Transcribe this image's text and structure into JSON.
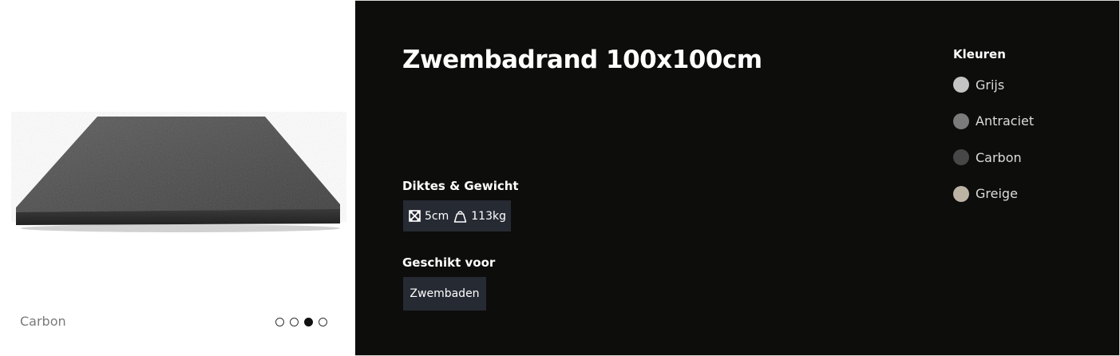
{
  "product": {
    "title": "Zwembadrand 100x100cm",
    "image_variant_label": "Carbon",
    "carousel": {
      "total_slides": 4,
      "active_slide": 3
    }
  },
  "specs": {
    "heading": "Diktes & Gewicht",
    "thickness": "5cm",
    "weight": "113kg",
    "thickness_icon": "dimensions-icon",
    "weight_icon": "weight-icon"
  },
  "suitable": {
    "heading": "Geschikt voor",
    "tag": "Zwembaden"
  },
  "colors": {
    "heading": "Kleuren",
    "items": [
      {
        "label": "Grijs",
        "hex": "#c4c4c4"
      },
      {
        "label": "Antraciet",
        "hex": "#7b7b7b"
      },
      {
        "label": "Carbon",
        "hex": "#474747"
      },
      {
        "label": "Greige",
        "hex": "#bcb3a5"
      }
    ]
  },
  "theme": {
    "panel_bg": "#0d0d0c",
    "chip_bg": "#262a33"
  }
}
